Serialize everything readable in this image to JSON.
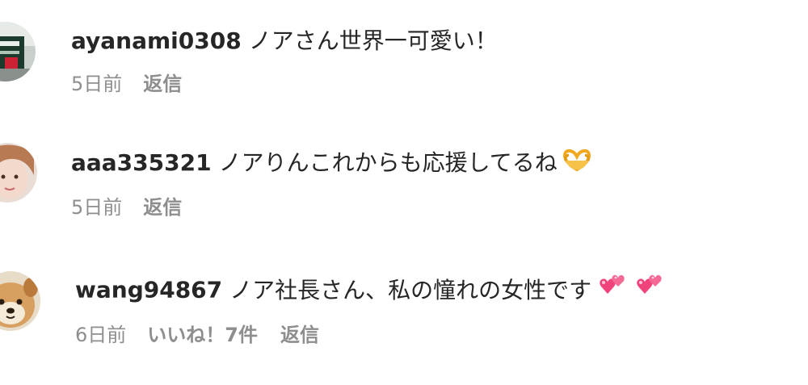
{
  "comments": [
    {
      "username": "ayanami0308",
      "text": "ノアさん世界一可愛い！",
      "time": "5日前",
      "likes": "",
      "reply_label": "返信"
    },
    {
      "username": "aaa335321",
      "text": "ノアりんこれからも応援してるね",
      "emoji": "heart-hands-emoji",
      "time": "5日前",
      "likes": "",
      "reply_label": "返信"
    },
    {
      "username": "wang94867",
      "text": "ノア社長さん、私の憧れの女性です",
      "emoji": "two-hearts-emoji",
      "time": "6日前",
      "likes": "いいね！7件",
      "reply_label": "返信"
    }
  ],
  "colors": {
    "primary_text": "#262626",
    "secondary_text": "#8e8e8e",
    "heart_pink": "#f0437a",
    "heart_hands": "#f7b733"
  }
}
